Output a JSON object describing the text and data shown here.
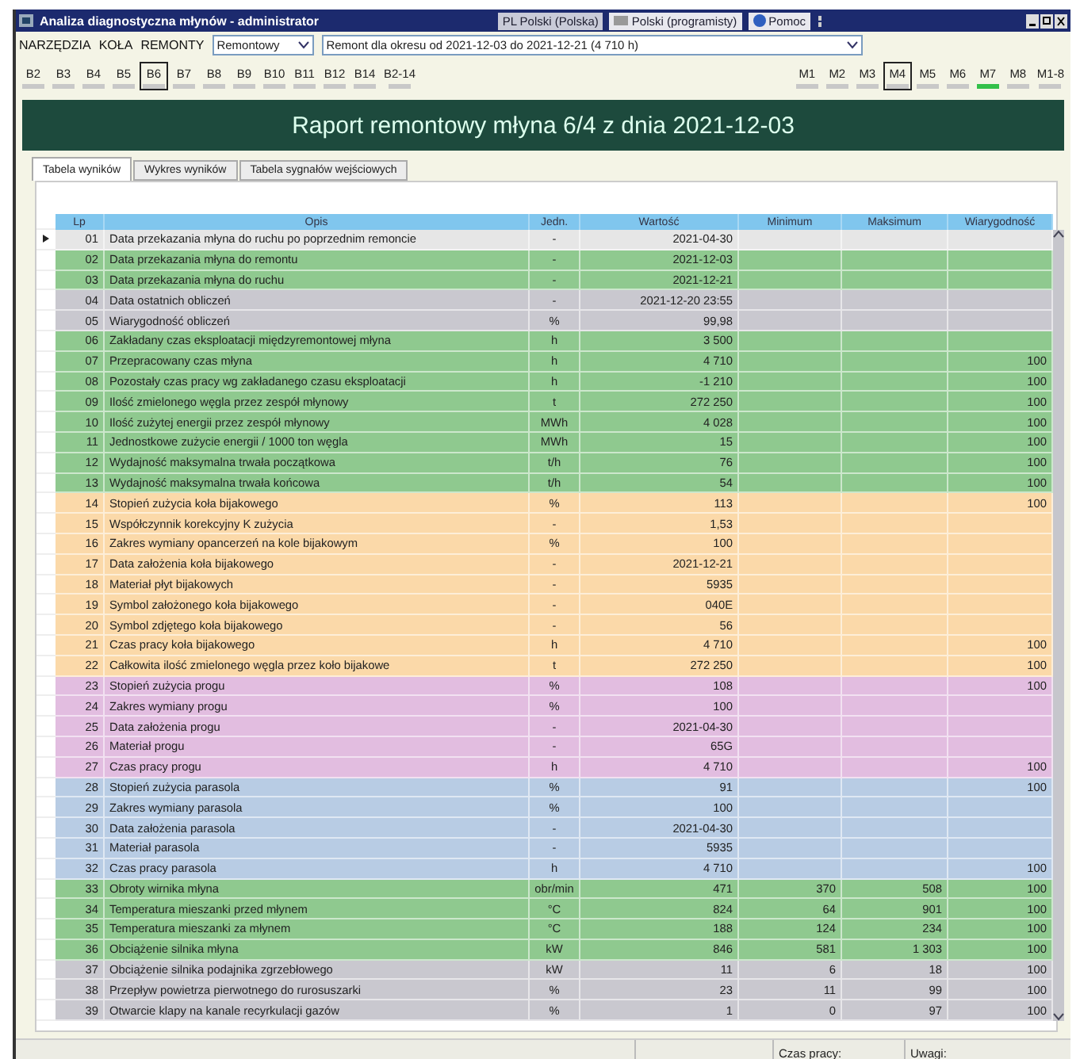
{
  "window": {
    "title": "Analiza diagnostyczna młynów - administrator"
  },
  "language_bar": {
    "input_language": "PL Polski (Polska)",
    "keyboard": "Polski (programisty)",
    "help": "Pomoc"
  },
  "menu": [
    {
      "label": "NARZĘDZIA"
    },
    {
      "label": "KOŁA"
    },
    {
      "label": "REMONTY"
    }
  ],
  "mode_select": {
    "value": "Remontowy"
  },
  "period_select": {
    "value": "Remont dla okresu od 2021-12-03 do 2021-12-21 (4 710 h)"
  },
  "b_buttons": [
    {
      "label": "B2",
      "selected": false
    },
    {
      "label": "B3",
      "selected": false
    },
    {
      "label": "B4",
      "selected": false
    },
    {
      "label": "B5",
      "selected": false
    },
    {
      "label": "B6",
      "selected": true
    },
    {
      "label": "B7",
      "selected": false
    },
    {
      "label": "B8",
      "selected": false
    },
    {
      "label": "B9",
      "selected": false
    },
    {
      "label": "B10",
      "selected": false
    },
    {
      "label": "B11",
      "selected": false
    },
    {
      "label": "B12",
      "selected": false
    },
    {
      "label": "B14",
      "selected": false
    },
    {
      "label": "B2-14",
      "selected": false
    }
  ],
  "m_buttons": [
    {
      "label": "M1",
      "selected": false,
      "highlighted": false
    },
    {
      "label": "M2",
      "selected": false,
      "highlighted": false
    },
    {
      "label": "M3",
      "selected": false,
      "highlighted": false
    },
    {
      "label": "M4",
      "selected": true,
      "highlighted": false
    },
    {
      "label": "M5",
      "selected": false,
      "highlighted": false
    },
    {
      "label": "M6",
      "selected": false,
      "highlighted": false
    },
    {
      "label": "M7",
      "selected": false,
      "highlighted": true
    },
    {
      "label": "M8",
      "selected": false,
      "highlighted": false
    },
    {
      "label": "M1-8",
      "selected": false,
      "highlighted": false
    }
  ],
  "report_title": "Raport remontowy młyna 6/4 z dnia 2021-12-03",
  "tabs": [
    {
      "label": "Tabela wyników",
      "selected": true
    },
    {
      "label": "Wykres wyników",
      "selected": false
    },
    {
      "label": "Tabela sygnałów wejściowych",
      "selected": false
    }
  ],
  "table": {
    "columns": [
      "Lp",
      "Opis",
      "Jedn.",
      "Wartość",
      "Minimum",
      "Maksimum",
      "Wiarygodność"
    ],
    "rows": [
      {
        "lp": "01",
        "opis": "Data przekazania młyna do ruchu po poprzednim remoncie",
        "unit": "-",
        "value": "2021-04-30",
        "color": "#e6e6e6",
        "selected": true
      },
      {
        "lp": "02",
        "opis": "Data przekazania młyna do remontu",
        "unit": "-",
        "value": "2021-12-03",
        "color": "#8fc98f",
        "selected": false
      },
      {
        "lp": "03",
        "opis": "Data przekazania młyna do ruchu",
        "unit": "-",
        "value": "2021-12-21",
        "color": "#8fc98f",
        "selected": false
      },
      {
        "lp": "04",
        "opis": "Data ostatnich obliczeń",
        "unit": "-",
        "value": "2021-12-20 23:55",
        "color": "#c9c8cf",
        "selected": false
      },
      {
        "lp": "05",
        "opis": "Wiarygodność obliczeń",
        "unit": "%",
        "value": "99,98",
        "color": "#c9c8cf",
        "selected": false
      },
      {
        "lp": "06",
        "opis": "Zakładany czas eksploatacji międzyremontowej młyna",
        "unit": "h",
        "value": "3 500",
        "color": "#8fc98f",
        "selected": false
      },
      {
        "lp": "07",
        "opis": "Przepracowany czas młyna",
        "unit": "h",
        "value": "4 710",
        "reliability": "100",
        "color": "#8fc98f",
        "selected": false
      },
      {
        "lp": "08",
        "opis": "Pozostały czas pracy wg zakładanego czasu eksploatacji",
        "unit": "h",
        "value": "-1 210",
        "reliability": "100",
        "color": "#8fc98f",
        "selected": false
      },
      {
        "lp": "09",
        "opis": "Ilość zmielonego węgla przez zespół młynowy",
        "unit": "t",
        "value": "272 250",
        "reliability": "100",
        "color": "#8fc98f",
        "selected": false
      },
      {
        "lp": "10",
        "opis": "Ilość zużytej energii przez zespół młynowy",
        "unit": "MWh",
        "value": "4 028",
        "reliability": "100",
        "color": "#8fc98f",
        "selected": false
      },
      {
        "lp": "11",
        "opis": "Jednostkowe zużycie energii / 1000 ton węgla",
        "unit": "MWh",
        "value": "15",
        "reliability": "100",
        "color": "#8fc98f",
        "selected": false
      },
      {
        "lp": "12",
        "opis": "Wydajność maksymalna trwała początkowa",
        "unit": "t/h",
        "value": "76",
        "reliability": "100",
        "color": "#8fc98f",
        "selected": false
      },
      {
        "lp": "13",
        "opis": "Wydajność maksymalna trwała końcowa",
        "unit": "t/h",
        "value": "54",
        "reliability": "100",
        "color": "#8fc98f",
        "selected": false
      },
      {
        "lp": "14",
        "opis": "Stopień zużycia koła bijakowego",
        "unit": "%",
        "value": "113",
        "reliability": "100",
        "color": "#fbd9a9",
        "selected": false
      },
      {
        "lp": "15",
        "opis": "Współczynnik korekcyjny K zużycia",
        "unit": "-",
        "value": "1,53",
        "color": "#fbd9a9",
        "selected": false
      },
      {
        "lp": "16",
        "opis": "Zakres wymiany opancerzeń na kole bijakowym",
        "unit": "%",
        "value": "100",
        "color": "#fbd9a9",
        "selected": false
      },
      {
        "lp": "17",
        "opis": "Data założenia koła bijakowego",
        "unit": "-",
        "value": "2021-12-21",
        "color": "#fbd9a9",
        "selected": false
      },
      {
        "lp": "18",
        "opis": "Materiał płyt bijakowych",
        "unit": "-",
        "value": "5935",
        "color": "#fbd9a9",
        "selected": false
      },
      {
        "lp": "19",
        "opis": "Symbol założonego koła bijakowego",
        "unit": "-",
        "value": "040E",
        "color": "#fbd9a9",
        "selected": false
      },
      {
        "lp": "20",
        "opis": "Symbol zdjętego koła bijakowego",
        "unit": "-",
        "value": "56",
        "color": "#fbd9a9",
        "selected": false
      },
      {
        "lp": "21",
        "opis": "Czas pracy koła bijakowego",
        "unit": "h",
        "value": "4 710",
        "reliability": "100",
        "color": "#fbd9a9",
        "selected": false
      },
      {
        "lp": "22",
        "opis": "Całkowita ilość zmielonego węgla przez koło bijakowe",
        "unit": "t",
        "value": "272 250",
        "reliability": "100",
        "color": "#fbd9a9",
        "selected": false
      },
      {
        "lp": "23",
        "opis": "Stopień zużycia progu",
        "unit": "%",
        "value": "108",
        "reliability": "100",
        "color": "#e2bde0",
        "selected": false
      },
      {
        "lp": "24",
        "opis": "Zakres wymiany progu",
        "unit": "%",
        "value": "100",
        "color": "#e2bde0",
        "selected": false
      },
      {
        "lp": "25",
        "opis": "Data założenia progu",
        "unit": "-",
        "value": "2021-04-30",
        "color": "#e2bde0",
        "selected": false
      },
      {
        "lp": "26",
        "opis": "Materiał progu",
        "unit": "-",
        "value": "65G",
        "color": "#e2bde0",
        "selected": false
      },
      {
        "lp": "27",
        "opis": "Czas pracy progu",
        "unit": "h",
        "value": "4 710",
        "reliability": "100",
        "color": "#e2bde0",
        "selected": false
      },
      {
        "lp": "28",
        "opis": "Stopień zużycia parasola",
        "unit": "%",
        "value": "91",
        "reliability": "100",
        "color": "#b8cce4",
        "selected": false
      },
      {
        "lp": "29",
        "opis": "Zakres wymiany parasola",
        "unit": "%",
        "value": "100",
        "color": "#b8cce4",
        "selected": false
      },
      {
        "lp": "30",
        "opis": "Data założenia parasola",
        "unit": "-",
        "value": "2021-04-30",
        "color": "#b8cce4",
        "selected": false
      },
      {
        "lp": "31",
        "opis": "Materiał parasola",
        "unit": "-",
        "value": "5935",
        "color": "#b8cce4",
        "selected": false
      },
      {
        "lp": "32",
        "opis": "Czas pracy parasola",
        "unit": "h",
        "value": "4 710",
        "reliability": "100",
        "color": "#b8cce4",
        "selected": false
      },
      {
        "lp": "33",
        "opis": "Obroty wirnika młyna",
        "unit": "obr/min",
        "value": "471",
        "min": "370",
        "max": "508",
        "reliability": "100",
        "color": "#8fc98f",
        "selected": false
      },
      {
        "lp": "34",
        "opis": "Temperatura mieszanki przed młynem",
        "unit": "°C",
        "value": "824",
        "min": "64",
        "max": "901",
        "reliability": "100",
        "color": "#8fc98f",
        "selected": false
      },
      {
        "lp": "35",
        "opis": "Temperatura mieszanki za młynem",
        "unit": "°C",
        "value": "188",
        "min": "124",
        "max": "234",
        "reliability": "100",
        "color": "#8fc98f",
        "selected": false
      },
      {
        "lp": "36",
        "opis": "Obciążenie silnika młyna",
        "unit": "kW",
        "value": "846",
        "min": "581",
        "max": "1 303",
        "reliability": "100",
        "color": "#8fc98f",
        "selected": false
      },
      {
        "lp": "37",
        "opis": "Obciążenie silnika podajnika zgrzebłowego",
        "unit": "kW",
        "value": "11",
        "min": "6",
        "max": "18",
        "reliability": "100",
        "color": "#c9c8cf",
        "selected": false
      },
      {
        "lp": "38",
        "opis": "Przepływ powietrza pierwotnego do rurosuszarki",
        "unit": "%",
        "value": "23",
        "min": "11",
        "max": "99",
        "reliability": "100",
        "color": "#c9c8cf",
        "selected": false
      },
      {
        "lp": "39",
        "opis": "Otwarcie klapy na kanale recyrkulacji gazów",
        "unit": "%",
        "value": "1",
        "min": "0",
        "max": "97",
        "reliability": "100",
        "color": "#c9c8cf",
        "selected": false
      }
    ]
  },
  "status_bar": [
    "Czas pracy:",
    "Uwagi:"
  ]
}
